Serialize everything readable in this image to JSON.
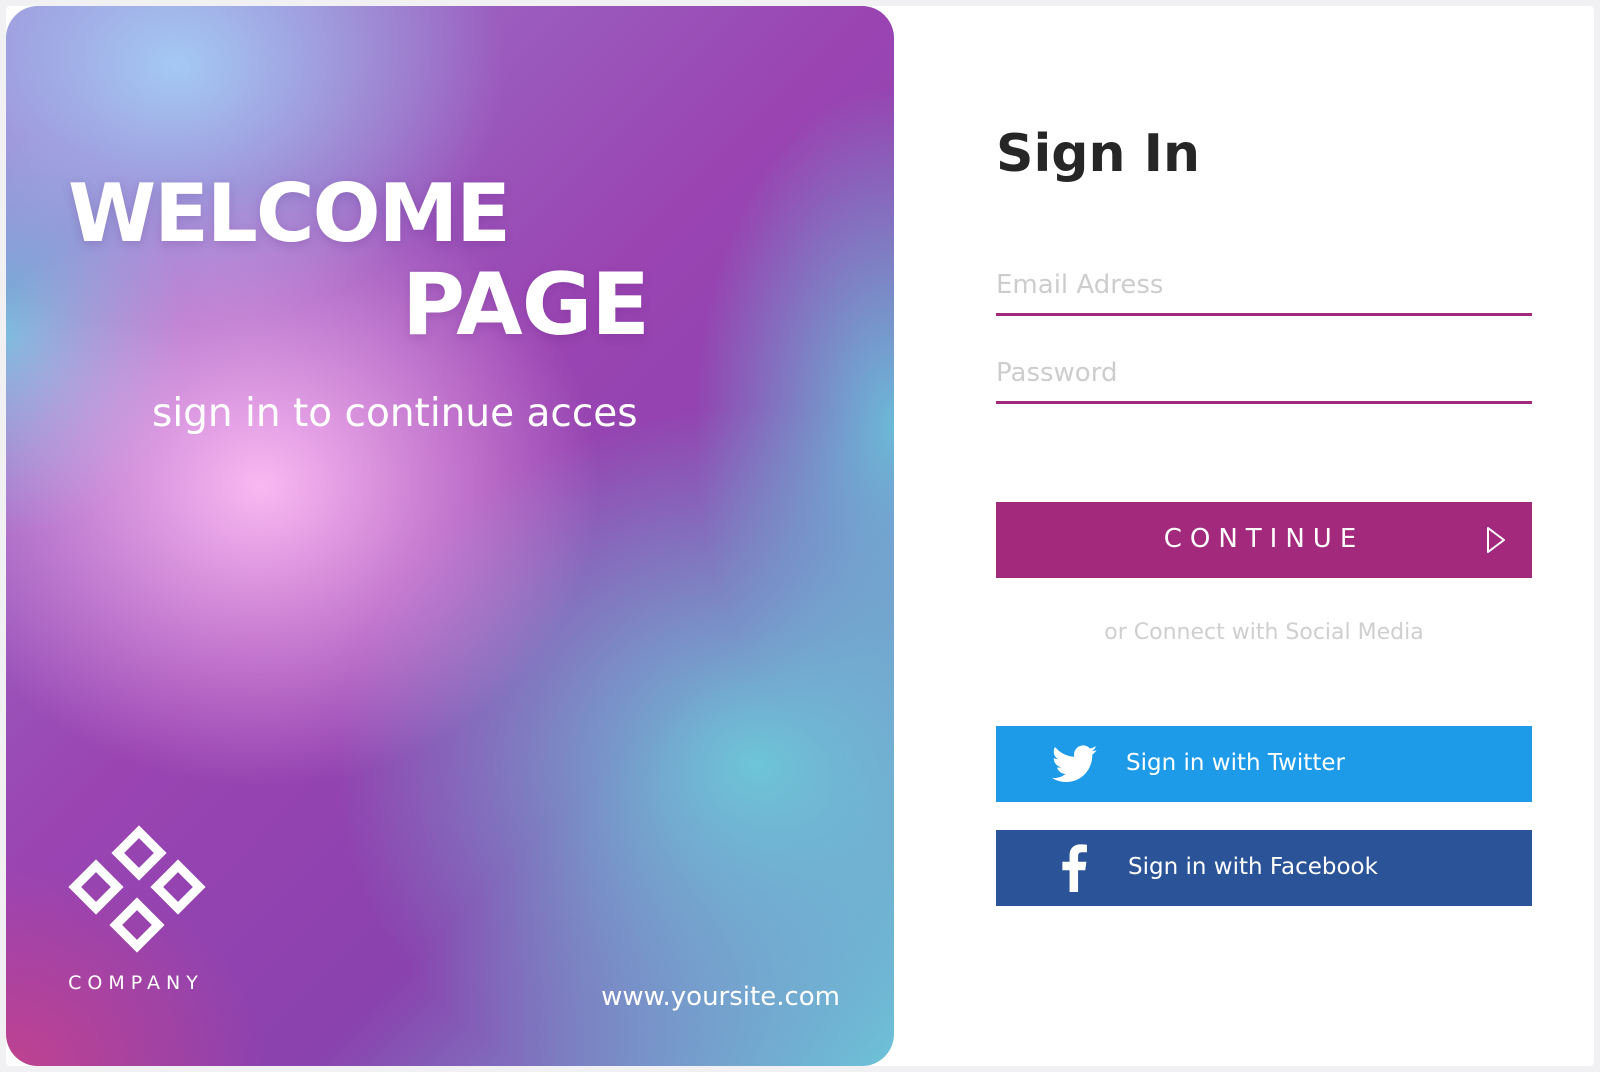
{
  "hero": {
    "title_line1": "WELCOME",
    "title_line2": "PAGE",
    "subtitle": "sign in to continue acces",
    "company_name": "COMPANY",
    "website": "www.yoursite.com",
    "logo_icon": "diamond-lattice-logo-icon"
  },
  "signin": {
    "title": "Sign In",
    "email_placeholder": "Email Adress",
    "email_value": "",
    "password_placeholder": "Password",
    "password_value": "",
    "continue_label": "CONTINUE",
    "continue_icon": "play-arrow-icon",
    "social_caption": "or Connect with Social Media",
    "twitter_label": "Sign in with Twitter",
    "twitter_icon": "twitter-bird-icon",
    "facebook_label": "Sign in with Facebook",
    "facebook_icon": "facebook-f-icon"
  },
  "colors": {
    "accent": "#a3297d",
    "twitter": "#1d9be9",
    "facebook": "#2a5497",
    "title_text": "#262626",
    "placeholder_text": "#cdcdcd"
  }
}
